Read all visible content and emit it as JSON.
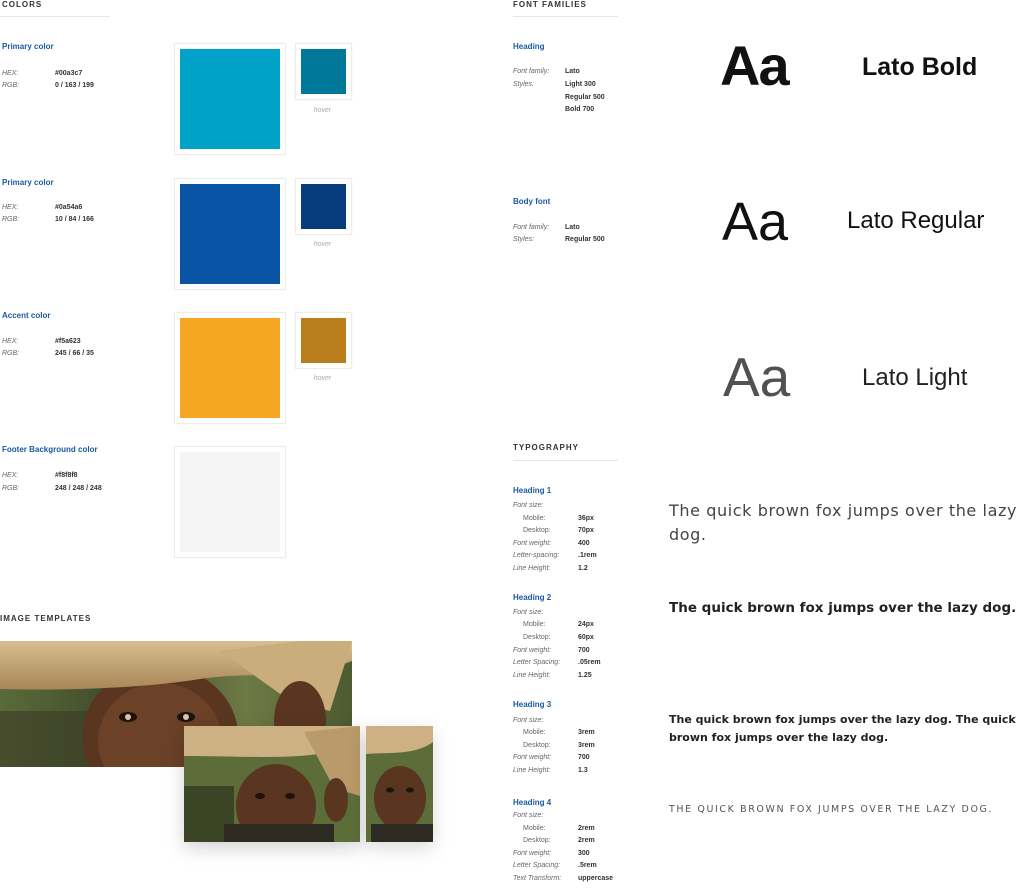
{
  "colors": {
    "section_title": "COLORS",
    "hex_label": "HEX:",
    "rgb_label": "RGB:",
    "hover_label": "hover",
    "items": [
      {
        "title": "Primary color",
        "hex": "#00a3c7",
        "rgb": "0 / 163 / 199",
        "swatch": "#00a3c7",
        "hover": "#00789a"
      },
      {
        "title": "Primary color",
        "hex": "#0a54a6",
        "rgb": "10 / 84 / 166",
        "swatch": "#0a54a6",
        "hover": "#073c7c"
      },
      {
        "title": "Accent color",
        "hex": "#f5a623",
        "rgb": "245 / 66 / 35",
        "swatch": "#f5a623",
        "hover": "#b97d1c"
      },
      {
        "title": "Footer Background color",
        "hex": "#f8f8f8",
        "rgb": "248 / 248 / 248",
        "swatch": "#f5f5f5"
      }
    ]
  },
  "font_families": {
    "section_title": "FONT FAMILIES",
    "heading": {
      "title": "Heading",
      "family_label": "Font family:",
      "family": "Lato",
      "styles_label": "Styles:",
      "styles": [
        "Light 300",
        "Regular 500",
        "Bold 700"
      ]
    },
    "body": {
      "title": "Body font",
      "family_label": "Font family:",
      "family": "Lato",
      "styles_label": "Styles:",
      "styles": [
        "Regular 500"
      ]
    }
  },
  "specimens": [
    {
      "aa": "Aa",
      "name": "Lato Bold"
    },
    {
      "aa": "Aa",
      "name": "Lato Regular"
    },
    {
      "aa": "Aa",
      "name": "Lato Light"
    }
  ],
  "typography": {
    "section_title": "TYPOGRAPHY",
    "headings": [
      {
        "title": "Heading 1",
        "rows": [
          [
            "Font size:",
            ""
          ],
          [
            "Mobile:",
            "36px"
          ],
          [
            "Desktop:",
            "70px"
          ],
          [
            "Font weight:",
            "400"
          ],
          [
            "Letter-spacing:",
            ".1rem"
          ],
          [
            "Line Height:",
            "1.2"
          ]
        ]
      },
      {
        "title": "Heading 2",
        "rows": [
          [
            "Font size:",
            ""
          ],
          [
            "Mobile:",
            "24px"
          ],
          [
            "Desktop:",
            "60px"
          ],
          [
            "Font weight:",
            "700"
          ],
          [
            "Letter Spacing:",
            ".05rem"
          ],
          [
            "Line Height:",
            "1.25"
          ]
        ]
      },
      {
        "title": "Heading 3",
        "rows": [
          [
            "Font size:",
            ""
          ],
          [
            "Mobile:",
            "3rem"
          ],
          [
            "Desktop:",
            "3rem"
          ],
          [
            "Font weight:",
            "700"
          ],
          [
            "Line Height:",
            "1.3"
          ]
        ]
      },
      {
        "title": "Heading 4",
        "rows": [
          [
            "Font size:",
            ""
          ],
          [
            "Mobile:",
            "2rem"
          ],
          [
            "Desktop:",
            "2rem"
          ],
          [
            "Font weight:",
            "300"
          ],
          [
            "Letter Spacing:",
            ".5rem"
          ],
          [
            "Text Transform:",
            "uppercase"
          ]
        ]
      }
    ],
    "samples": [
      "The quick brown fox jumps over the lazy dog.",
      "The quick brown fox jumps over the lazy dog.",
      "The quick brown fox jumps over the lazy dog. The quick brown fox jumps over the lazy dog.",
      "THE QUICK BROWN FOX JUMPS OVER THE LAZY DOG."
    ]
  },
  "image_templates": {
    "section_title": "IMAGE TEMPLATES"
  }
}
